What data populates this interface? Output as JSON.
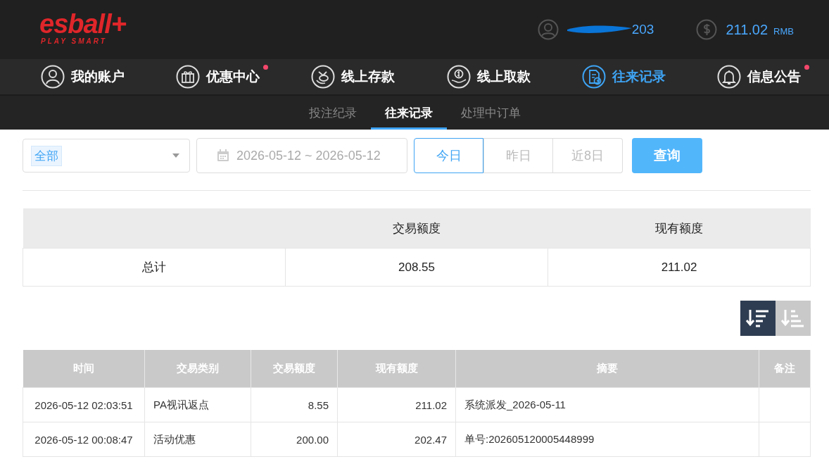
{
  "header": {
    "logo": "esball+",
    "tagline": "PLAY SMART",
    "username": "203",
    "balance": "211.02",
    "currency": "RMB"
  },
  "nav": [
    {
      "label": "我的账户",
      "kind": "person",
      "selected": false,
      "badge": false
    },
    {
      "label": "优惠中心",
      "kind": "gift",
      "selected": false,
      "badge": true
    },
    {
      "label": "线上存款",
      "kind": "deposit",
      "selected": false,
      "badge": false
    },
    {
      "label": "线上取款",
      "kind": "withdraw",
      "selected": false,
      "badge": false
    },
    {
      "label": "往来记录",
      "kind": "records",
      "selected": true,
      "badge": false
    },
    {
      "label": "信息公告",
      "kind": "bell",
      "selected": false,
      "badge": true
    }
  ],
  "subtabs": [
    {
      "label": "投注纪录",
      "selected": false
    },
    {
      "label": "往来记录",
      "selected": true
    },
    {
      "label": "处理中订单",
      "selected": false
    }
  ],
  "filters": {
    "type_tag": "全部",
    "date_range": "2026-05-12 ~ 2026-05-12",
    "ranges": [
      {
        "label": "今日",
        "selected": true
      },
      {
        "label": "昨日",
        "selected": false
      },
      {
        "label": "近8日",
        "selected": false
      }
    ],
    "query_button": "查询"
  },
  "summary": {
    "columns": [
      "交易额度",
      "现有额度"
    ],
    "row": {
      "label": "总计",
      "values": [
        "208.55",
        "211.02"
      ]
    }
  },
  "sort_buttons": [
    {
      "kind": "desc",
      "selected": true
    },
    {
      "kind": "asc",
      "selected": false
    }
  ],
  "table": {
    "columns": [
      "时间",
      "交易类别",
      "交易额度",
      "现有额度",
      "摘要",
      "备注"
    ],
    "rows": [
      [
        "2026-05-12 02:03:51",
        "PA视讯返点",
        "8.55",
        "211.02",
        "系统派发_2026-05-11",
        ""
      ],
      [
        "2026-05-12 00:08:47",
        "活动优惠",
        "200.00",
        "202.47",
        "单号:202605120005448999",
        ""
      ]
    ]
  }
}
